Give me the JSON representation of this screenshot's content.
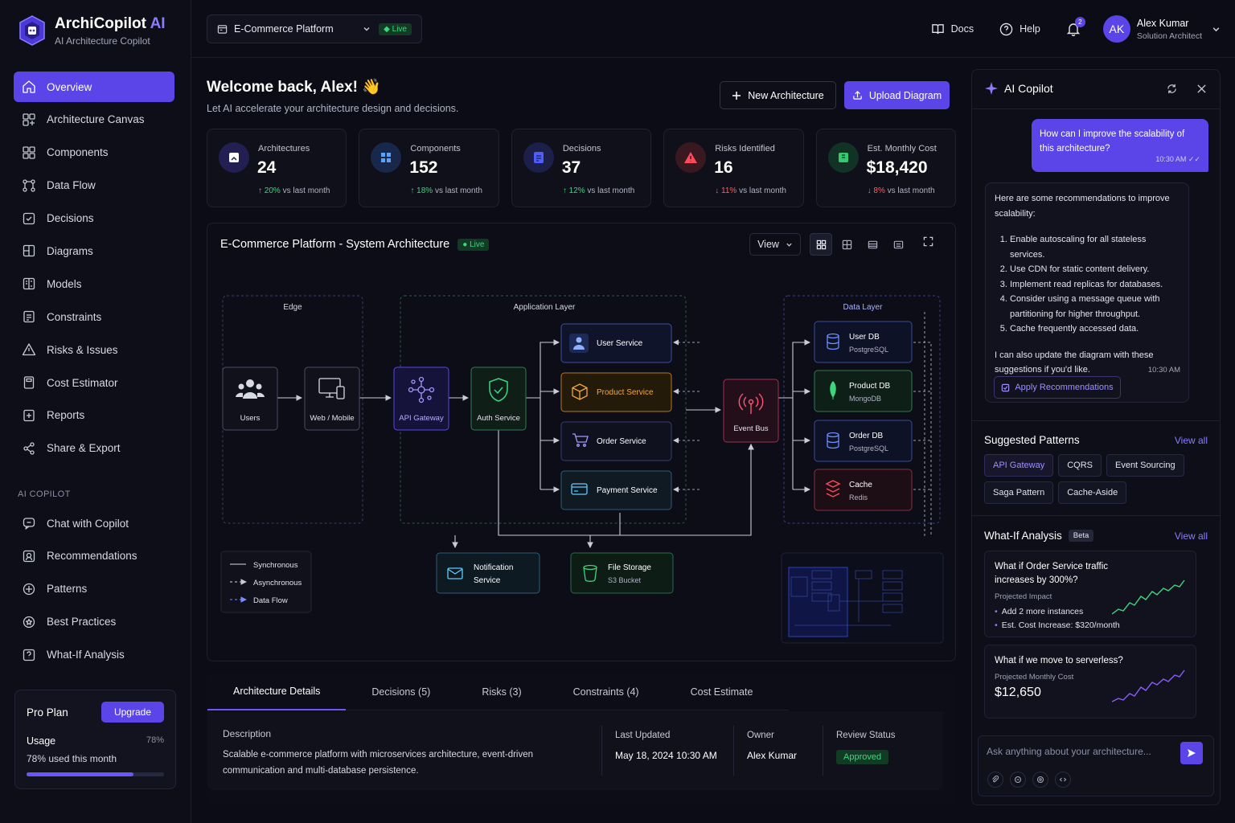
{
  "brand": {
    "name": "ArchiCopilot",
    "name_accent": "AI",
    "subtitle": "AI Architecture Copilot"
  },
  "nav": [
    {
      "label": "Overview",
      "icon": "home-icon",
      "active": true
    },
    {
      "label": "Architecture Canvas",
      "icon": "canvas-icon"
    },
    {
      "label": "Components",
      "icon": "components-icon"
    },
    {
      "label": "Data Flow",
      "icon": "data-flow-icon"
    },
    {
      "label": "Decisions",
      "icon": "decisions-icon"
    },
    {
      "label": "Diagrams",
      "icon": "diagrams-icon"
    },
    {
      "label": "Models",
      "icon": "models-icon"
    },
    {
      "label": "Constraints",
      "icon": "constraints-icon"
    },
    {
      "label": "Risks & Issues",
      "icon": "warning-icon"
    },
    {
      "label": "Cost Estimator",
      "icon": "calculator-icon"
    },
    {
      "label": "Reports",
      "icon": "reports-icon"
    },
    {
      "label": "Share & Export",
      "icon": "share-icon"
    }
  ],
  "nav_section": "AI COPILOT",
  "nav_copilot": [
    {
      "label": "Chat with Copilot",
      "icon": "chat-icon"
    },
    {
      "label": "Recommendations",
      "icon": "recommendations-icon"
    },
    {
      "label": "Patterns",
      "icon": "patterns-icon"
    },
    {
      "label": "Best Practices",
      "icon": "best-practices-icon"
    },
    {
      "label": "What-If Analysis",
      "icon": "what-if-icon"
    }
  ],
  "plan": {
    "title": "Pro Plan",
    "upgrade": "Upgrade",
    "usage_label": "Usage",
    "usage_pct_label": "78%",
    "usage_text": "78% used this month",
    "usage_fraction": 0.78
  },
  "topbar": {
    "project": "E-Commerce Platform",
    "live": "Live",
    "docs": "Docs",
    "help": "Help",
    "notifications": "2",
    "user_initials": "AK",
    "user_name": "Alex Kumar",
    "user_role": "Solution Architect"
  },
  "welcome": {
    "title": "Welcome back, Alex! 👋",
    "subtitle": "Let AI accelerate your architecture design and decisions."
  },
  "actions": {
    "new": "New Architecture",
    "upload": "Upload Diagram"
  },
  "stats": [
    {
      "label": "Architectures",
      "value": "24",
      "change": "20%",
      "dir": "up",
      "suffix": "vs last month",
      "color": "#6d5cff",
      "bg": "#231f52"
    },
    {
      "label": "Components",
      "value": "152",
      "change": "18%",
      "dir": "up",
      "suffix": "vs last month",
      "color": "#5aa2ff",
      "bg": "#18284a"
    },
    {
      "label": "Decisions",
      "value": "37",
      "change": "12%",
      "dir": "up",
      "suffix": "vs last month",
      "color": "#6d7dff",
      "bg": "#1c1f4a"
    },
    {
      "label": "Risks Identified",
      "value": "16",
      "change": "11%",
      "dir": "down",
      "suffix": "vs last month",
      "color": "#ff4a5c",
      "bg": "#3a1820"
    },
    {
      "label": "Est. Monthly Cost",
      "value": "$18,420",
      "change": "8%",
      "dir": "down",
      "suffix": "vs last month",
      "color": "#36c96d",
      "bg": "#123226"
    }
  ],
  "arch": {
    "title": "E-Commerce Platform - System Architecture",
    "live": "Live",
    "view": "View",
    "groups": {
      "edge": "Edge",
      "app": "Application Layer",
      "data": "Data Layer"
    },
    "nodes": {
      "users": "Users",
      "web": "Web / Mobile",
      "gateway": "API Gateway",
      "auth": "Auth Service",
      "user_service": "User Service",
      "product_service": "Product Service",
      "order_service": "Order Service",
      "payment_service": "Payment Service",
      "event_bus": "Event Bus",
      "user_db": "User DB",
      "user_db_sub": "PostgreSQL",
      "product_db": "Product DB",
      "product_db_sub": "MongoDB",
      "order_db": "Order DB",
      "order_db_sub": "PostgreSQL",
      "cache": "Cache",
      "cache_sub": "Redis",
      "notification_1": "Notification",
      "notification_2": "Service",
      "storage": "File Storage",
      "storage_sub": "S3 Bucket"
    },
    "legend": {
      "sync": "Synchronous",
      "async": "Asynchronous",
      "flow": "Data Flow"
    }
  },
  "tabs": [
    {
      "label": "Architecture Details",
      "active": true
    },
    {
      "label": "Decisions (5)"
    },
    {
      "label": "Risks (3)"
    },
    {
      "label": "Constraints (4)"
    },
    {
      "label": "Cost Estimate"
    }
  ],
  "details": {
    "desc_label": "Description",
    "desc": "Scalable e-commerce platform with microservices architecture, event-driven communication and multi-database persistence.",
    "updated_label": "Last Updated",
    "updated": "May 18, 2024 10:30 AM",
    "owner_label": "Owner",
    "owner": "Alex Kumar",
    "review_label": "Review Status",
    "review": "Approved"
  },
  "copilot": {
    "title": "AI Copilot",
    "user_msg": "How can I improve the scalability of this architecture?",
    "user_time": "10:30 AM ✓✓",
    "ai_intro": "Here are some recommendations to improve scalability:",
    "ai_items": [
      "Enable autoscaling for all stateless services.",
      "Use CDN for static content delivery.",
      "Implement read replicas for databases.",
      "Consider using a message queue with partitioning for higher throughput.",
      "Cache frequently accessed data."
    ],
    "ai_outro": "I can also update the diagram with these suggestions if you'd like.",
    "ai_time": "10:30 AM",
    "apply": "Apply Recommendations",
    "patterns_title": "Suggested Patterns",
    "view_all": "View all",
    "patterns": [
      "API Gateway",
      "CQRS",
      "Event Sourcing",
      "Saga Pattern",
      "Cache-Aside"
    ],
    "whatif_title": "What-If Analysis",
    "beta": "Beta",
    "whatif1": {
      "q": "What if Order Service traffic increases by 300%?",
      "sub": "Projected Impact",
      "items": [
        "Add 2 more instances",
        "Est. Cost Increase: $320/month"
      ]
    },
    "whatif2": {
      "q": "What if we move to serverless?",
      "sub": "Projected Monthly Cost",
      "value": "$12,650"
    },
    "ask_placeholder": "Ask anything about your architecture..."
  },
  "colors": {
    "accent": "#5b45e8",
    "success": "#3fd57f",
    "danger": "#ff5f5f"
  }
}
